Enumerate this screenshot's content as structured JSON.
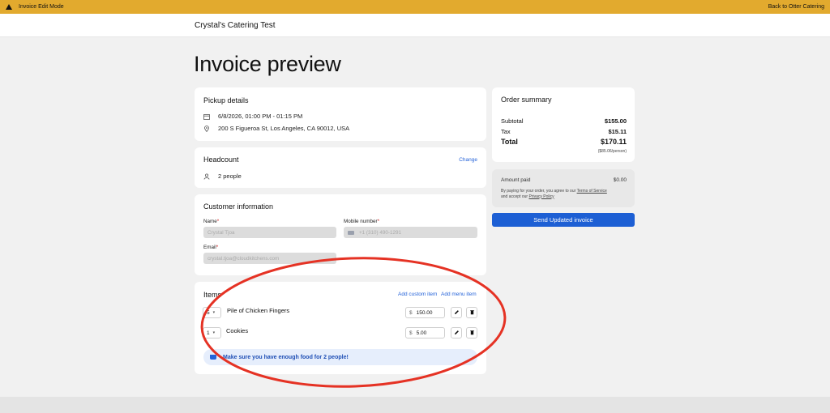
{
  "banner": {
    "mode_label": "Invoice Edit Mode",
    "back_link": "Back to Otter Catering"
  },
  "header": {
    "store_name": "Crystal's Catering Test"
  },
  "page": {
    "title": "Invoice preview"
  },
  "pickup": {
    "title": "Pickup details",
    "datetime": "6/8/2026, 01:00 PM - 01:15 PM",
    "address": "200 S Figueroa St, Los Angeles, CA 90012, USA"
  },
  "headcount": {
    "title": "Headcount",
    "change_label": "Change",
    "value": "2 people"
  },
  "customer": {
    "title": "Customer information",
    "name_label": "Name",
    "name_value": "Crystal Tjoa",
    "mobile_label": "Mobile number",
    "mobile_value": "+1 (310) 490-1291",
    "email_label": "Email",
    "email_value": "crystal.tjoa@cloudkitchens.com",
    "required_mark": "*"
  },
  "items": {
    "title": "Items",
    "add_custom_label": "Add custom item",
    "add_menu_label": "Add menu item",
    "currency": "$",
    "list": [
      {
        "qty": "5",
        "name": "Pile of Chicken Fingers",
        "price": "150.00"
      },
      {
        "qty": "1",
        "name": "Cookies",
        "price": "5.00"
      }
    ],
    "notice": "Make sure you have enough food for 2 people!"
  },
  "summary": {
    "title": "Order summary",
    "subtotal_label": "Subtotal",
    "subtotal_value": "$155.00",
    "tax_label": "Tax",
    "tax_value": "$15.11",
    "total_label": "Total",
    "total_value": "$170.11",
    "per_person": "($85.06/person)"
  },
  "payment": {
    "amount_paid_label": "Amount paid",
    "amount_paid_value": "$0.00",
    "terms_prefix": "By paying for your order, you agree to our ",
    "terms_link": "Terms of Service",
    "terms_mid": "and accept our ",
    "privacy_link": "Privacy Policy",
    "send_label": "Send Updated invoice"
  },
  "colors": {
    "banner": "#e2aa2e",
    "primary": "#1d5fd4",
    "annotation": "#e53224"
  }
}
